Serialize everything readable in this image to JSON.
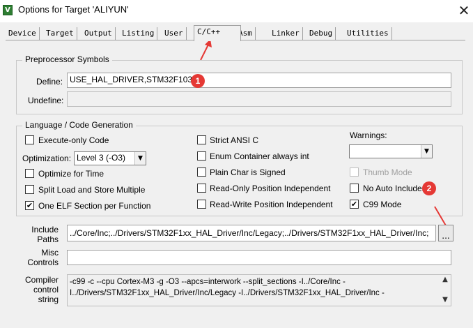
{
  "window": {
    "title": "Options for Target 'ALIYUN'",
    "close_glyph": "✕",
    "icon_glyph": "V"
  },
  "tabs": [
    "Device",
    "Target",
    "Output",
    "Listing",
    "User",
    "C/C++",
    "Asm",
    "Linker",
    "Debug",
    "Utilities"
  ],
  "active_tab": "C/C++",
  "preprocessor": {
    "legend": "Preprocessor Symbols",
    "define_label": "Define:",
    "define_value": "USE_HAL_DRIVER,STM32F103",
    "undefine_label": "Undefine:",
    "undefine_value": ""
  },
  "langgen": {
    "legend": "Language / Code Generation",
    "execute_only": {
      "label": "Execute-only Code",
      "checked": false
    },
    "optimization_label": "Optimization:",
    "optimization_value": "Level 3 (-O3)",
    "optimize_time": {
      "label": "Optimize for Time",
      "checked": false
    },
    "split_load": {
      "label": "Split Load and Store Multiple",
      "checked": false
    },
    "one_elf": {
      "label": "One ELF Section per Function",
      "checked": true,
      "mark": "✔"
    },
    "strict_ansi": {
      "label": "Strict ANSI C",
      "checked": false
    },
    "enum_int": {
      "label": "Enum Container always int",
      "checked": false
    },
    "plain_char": {
      "label": "Plain Char is Signed",
      "checked": false
    },
    "ro_pi": {
      "label": "Read-Only Position Independent",
      "checked": false
    },
    "rw_pi": {
      "label": "Read-Write Position Independent",
      "checked": false
    },
    "warnings_label": "Warnings:",
    "warnings_value": "",
    "thumb_mode": {
      "label": "Thumb Mode",
      "checked": false,
      "disabled": true
    },
    "no_auto_include": {
      "label": "No Auto Includes",
      "checked": false
    },
    "c99_mode": {
      "label": "C99 Mode",
      "checked": true,
      "mark": "✔"
    }
  },
  "include_paths": {
    "label": "Include\nPaths",
    "value": "../Core/Inc;../Drivers/STM32F1xx_HAL_Driver/Inc/Legacy;../Drivers/STM32F1xx_HAL_Driver/Inc;",
    "browse_label": "..."
  },
  "misc_controls": {
    "label": "Misc\nControls",
    "value": ""
  },
  "compiler_string": {
    "label": "Compiler\ncontrol\nstring",
    "value": "-c99 -c --cpu Cortex-M3 -g -O3 --apcs=interwork --split_sections -I../Core/Inc -\nI../Drivers/STM32F1xx_HAL_Driver/Inc/Legacy -I../Drivers/STM32F1xx_HAL_Driver/Inc -",
    "scroll_up": "▲",
    "scroll_down": "▼"
  },
  "annotations": {
    "badge1": "1",
    "badge2": "2",
    "color": "#e53935"
  },
  "dropdown_glyph": "▼"
}
